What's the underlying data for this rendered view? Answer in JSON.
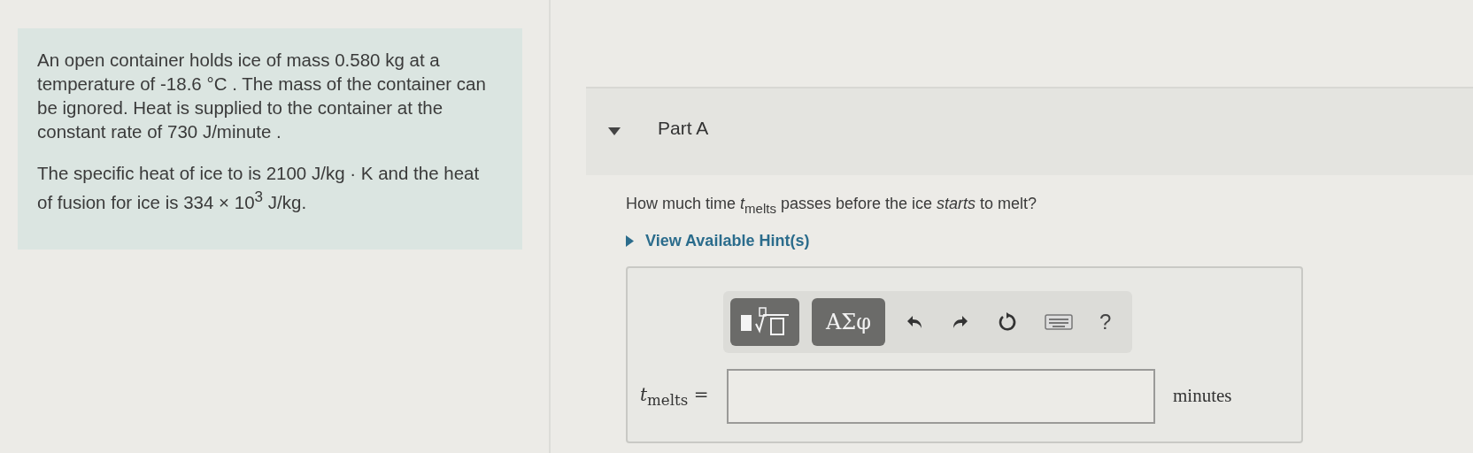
{
  "problem": {
    "paragraphs": [
      "An open container holds ice of mass 0.580 kg at a temperature of -18.6 °C . The mass of the container can be ignored. Heat is supplied to the container at the constant rate of 730 J/minute .",
      "The specific heat of ice to is 2100 J/kg · K and the heat of fusion for ice is 334 × 10$^{3}$ J/kg."
    ]
  },
  "part": {
    "title": "Part A",
    "expanded": true
  },
  "question": "How much time *t*$_{melts}$ passes before the ice *starts* to melt?",
  "hints": {
    "label": "View Available Hint(s)",
    "expanded": false
  },
  "answer": {
    "toolbar": [
      {
        "kind": "templates"
      },
      {
        "kind": "symbols",
        "label": "ΑΣφ"
      },
      {
        "kind": "undo"
      },
      {
        "kind": "redo"
      },
      {
        "kind": "reset"
      },
      {
        "kind": "keyboard"
      },
      {
        "kind": "help",
        "label": "?"
      }
    ],
    "label": "*t*$_{melts}$ =",
    "unit": "minutes"
  }
}
